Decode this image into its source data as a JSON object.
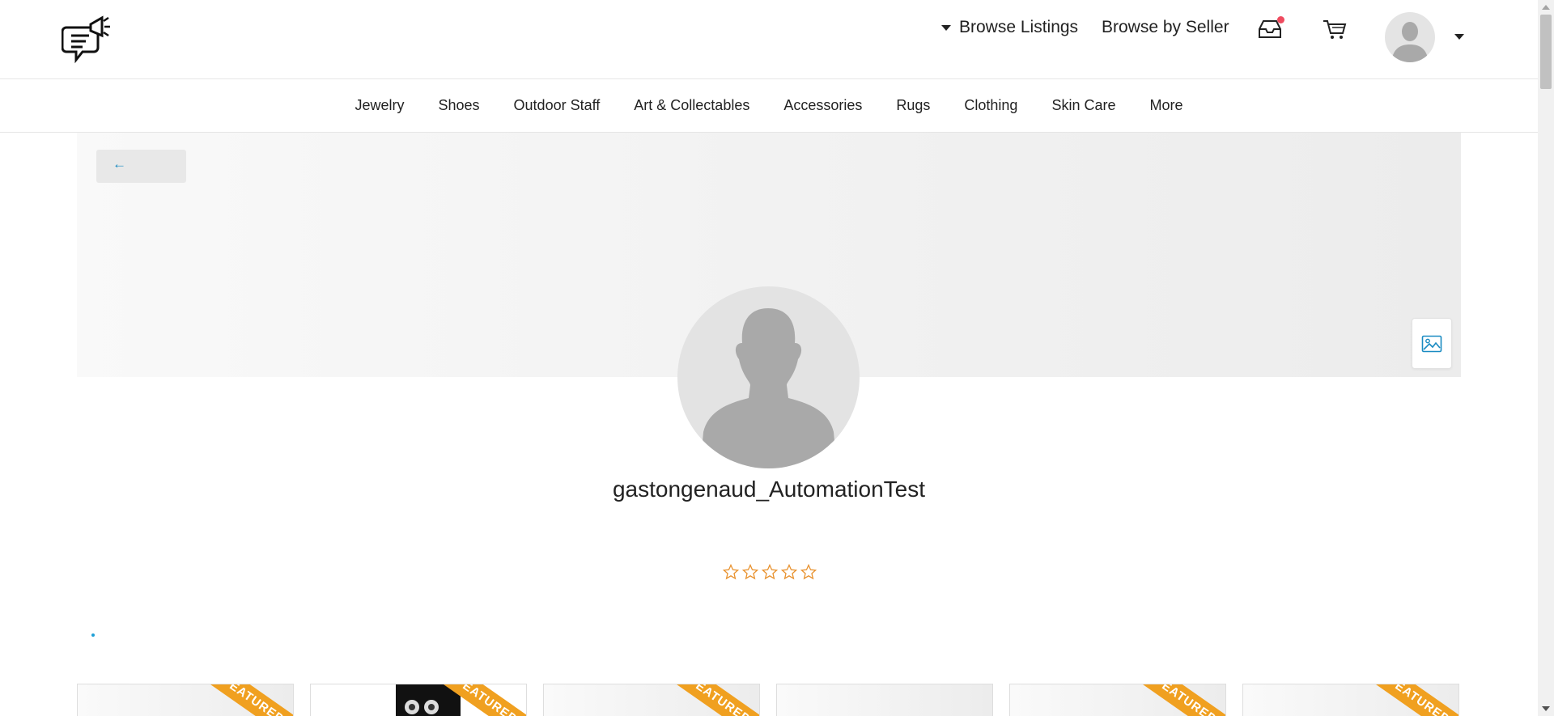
{
  "header": {
    "browse_listings": "Browse Listings",
    "browse_by_seller": "Browse by Seller",
    "icons": [
      "logo-icon",
      "inbox-icon",
      "cart-icon",
      "avatar",
      "chevron-down-icon"
    ]
  },
  "categories": [
    "Jewelry",
    "Shoes",
    "Outdoor Staff",
    "Art & Collectables",
    "Accessories",
    "Rugs",
    "Clothing",
    "Skin Care",
    "More"
  ],
  "banner": {
    "back_arrow": "←"
  },
  "profile": {
    "username": "gastongenaud_AutomationTest",
    "rating": 0,
    "max_rating": 5
  },
  "listings": {
    "ribbon_text": "FEATURED",
    "cards": [
      {
        "featured": true,
        "has_image": false
      },
      {
        "featured": true,
        "has_image": true
      },
      {
        "featured": true,
        "has_image": false
      },
      {
        "featured": false,
        "has_image": false
      },
      {
        "featured": true,
        "has_image": false
      },
      {
        "featured": true,
        "has_image": false
      }
    ]
  },
  "colors": {
    "accent": "#1a8bc2",
    "star": "#e8912d",
    "ribbon": "#f0a020",
    "notification": "#ef4b5f"
  }
}
